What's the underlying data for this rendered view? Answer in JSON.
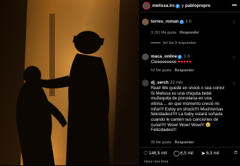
{
  "header": {
    "username": "melissa.lrc",
    "joiner": "y",
    "collaborator": "pablopreprе",
    "more_icon": "more-horizontal-icon"
  },
  "comments": [
    {
      "username": "torres_roman",
      "time": "1 h",
      "text": "",
      "likes": "3.151 Me gusta",
      "reply": "Responder",
      "view_replies": "Ver las 9 respuestas"
    },
    {
      "username": "maca_online",
      "time": "1 h",
      "text": "Cleeeeeeeee",
      "hearts": "♥♥♥♥♥",
      "likes": "53 Me gusta",
      "reply": "Responder"
    },
    {
      "username": "dj_serch",
      "time": "33 min",
      "text": "Real! Me quedé en shock o sea como! Si Melissa es una chiquita bebé muñequita de porcelana en una vitrina.... en que momento creció mi niña!!!! Estoy en shock!!!! Muchisimas felicidades!!!!! La baby estará soñada cuando le canten sus canciones de cuna!!!!! Wow! Wow! Wow!!! 🥹 Felicidades!!!",
      "likes": "95 Me gusta",
      "reply": "Responder"
    }
  ],
  "footer": {
    "likes": "146,5 mil",
    "comments": "6,5 mil",
    "shares": "6,3 mil",
    "time_ago": "Hace una hora",
    "icons": [
      "heart-icon",
      "comment-icon",
      "share-icon",
      "bookmark-icon"
    ]
  },
  "colors": {
    "accent": "#3897f0",
    "like": "#ff3040",
    "muted": "#a8a8a8"
  }
}
